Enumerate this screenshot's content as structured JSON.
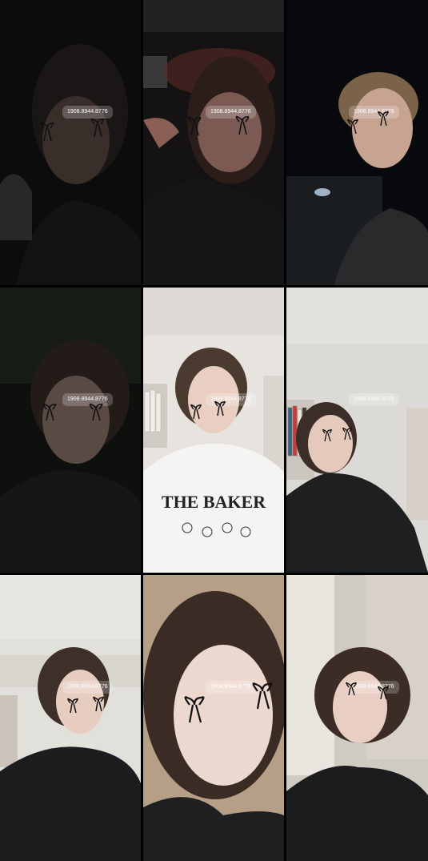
{
  "watermark": "1908.8944.8776",
  "shirt_print": {
    "tile5": "THE BAKER"
  }
}
